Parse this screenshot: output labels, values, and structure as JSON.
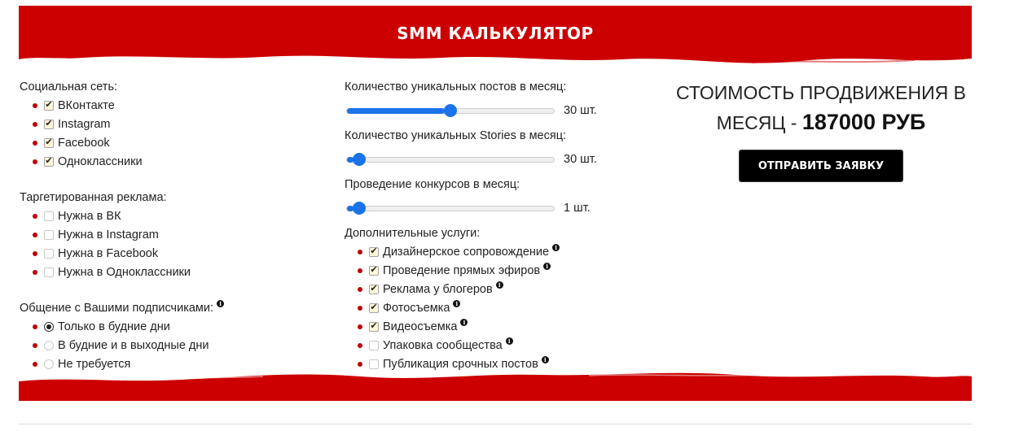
{
  "header": {
    "title": "SMM КАЛЬКУЛЯТОР"
  },
  "colors": {
    "brand_red": "#cc0000",
    "slider_blue": "#1a73e8",
    "bullet_red": "#c00000"
  },
  "social": {
    "title": "Социальная сеть:",
    "items": [
      {
        "label": "ВКонтакте",
        "checked": true
      },
      {
        "label": "Instagram",
        "checked": true
      },
      {
        "label": "Facebook",
        "checked": true
      },
      {
        "label": "Одноклассники",
        "checked": true
      }
    ]
  },
  "targeting": {
    "title": "Таргетированная реклама:",
    "items": [
      {
        "label": "Нужна в ВК",
        "checked": false
      },
      {
        "label": "Нужна в Instagram",
        "checked": false
      },
      {
        "label": "Нужна в Facebook",
        "checked": false
      },
      {
        "label": "Нужна в Одноклассники",
        "checked": false
      }
    ]
  },
  "communication": {
    "title": "Общение с Вашими подписчиками:",
    "options": [
      {
        "label": "Только в будние дни",
        "selected": true
      },
      {
        "label": "В будние и в выходные дни",
        "selected": false
      },
      {
        "label": "Не требуется",
        "selected": false
      }
    ]
  },
  "sliders": [
    {
      "title": "Количество уникальных постов в месяц:",
      "value_label": "30 шт.",
      "fraction": 0.47
    },
    {
      "title": "Количество уникальных Stories в месяц:",
      "value_label": "30 шт.",
      "fraction": 0.03
    },
    {
      "title": "Проведение конкурсов в месяц:",
      "value_label": "1 шт.",
      "fraction": 0.03
    }
  ],
  "extras": {
    "title": "Дополнительные услуги:",
    "items": [
      {
        "label": "Дизайнерское сопровождение",
        "checked": true
      },
      {
        "label": "Проведение прямых эфиров",
        "checked": true
      },
      {
        "label": "Реклама у блогеров",
        "checked": true
      },
      {
        "label": "Фотосъемка",
        "checked": true
      },
      {
        "label": "Видеосъемка",
        "checked": true
      },
      {
        "label": "Упаковка сообщества",
        "checked": false
      },
      {
        "label": "Публикация срочных постов",
        "checked": false
      }
    ]
  },
  "result": {
    "line1": "СТОИМОСТЬ ПРОДВИЖЕНИЯ В",
    "line2_prefix": "МЕСЯЦ - ",
    "price": "187000 РУБ",
    "button_label": "ОТПРАВИТЬ ЗАЯВКУ"
  },
  "icons": {
    "info": "info-icon",
    "check": "check-icon"
  }
}
